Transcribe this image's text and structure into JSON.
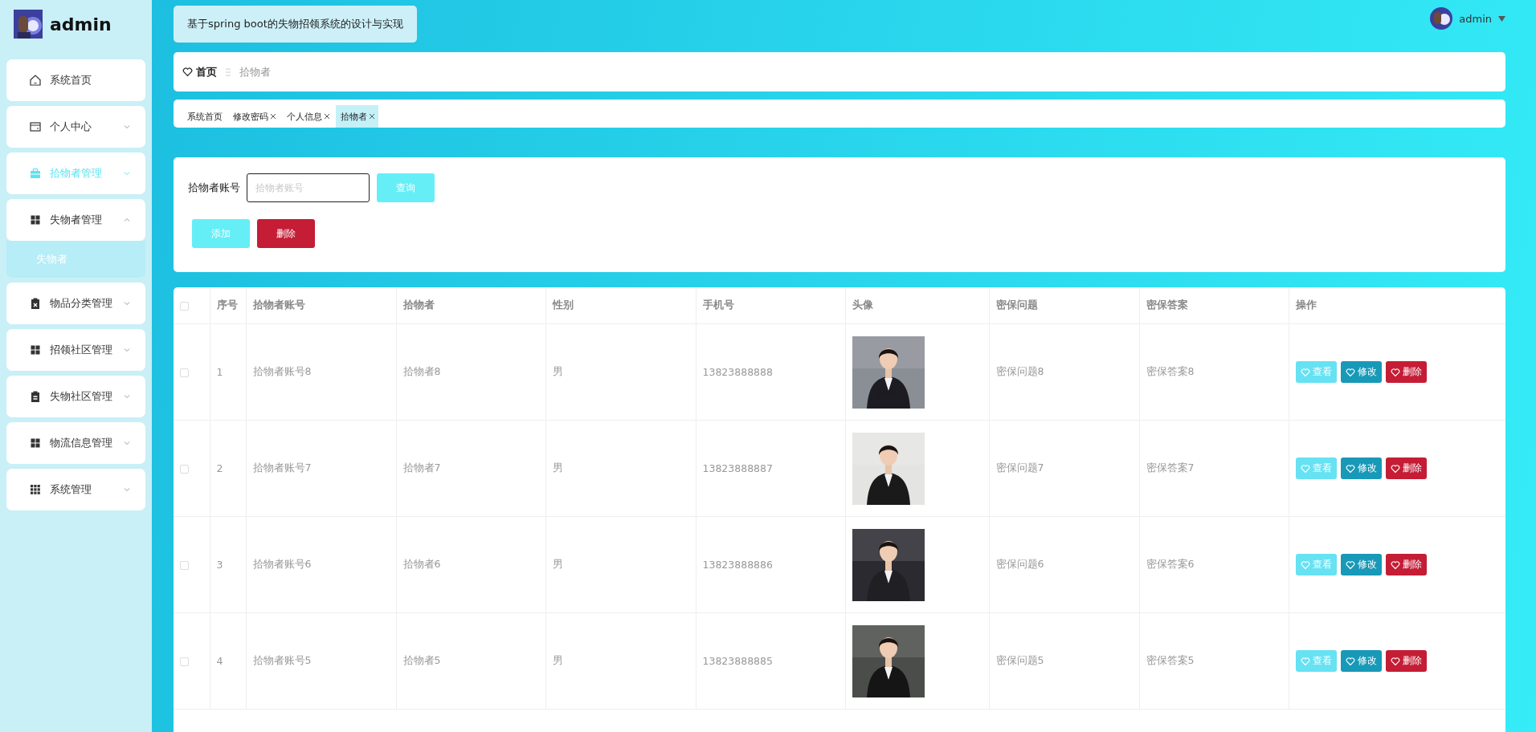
{
  "sidebar": {
    "brand": "admin",
    "items": [
      {
        "label": "系统首页",
        "kind": "link",
        "selected": false
      },
      {
        "label": "个人中心",
        "kind": "submenu",
        "selected": false,
        "expanded": false
      },
      {
        "label": "拾物者管理",
        "kind": "submenu",
        "selected": true,
        "expanded": false
      },
      {
        "label": "失物者管理",
        "kind": "submenu",
        "selected": false,
        "expanded": true,
        "children": [
          {
            "label": "失物者",
            "hovered": true
          }
        ]
      },
      {
        "label": "物品分类管理",
        "kind": "submenu",
        "selected": false,
        "expanded": false
      },
      {
        "label": "招领社区管理",
        "kind": "submenu",
        "selected": false,
        "expanded": false
      },
      {
        "label": "失物社区管理",
        "kind": "submenu",
        "selected": false,
        "expanded": false
      },
      {
        "label": "物流信息管理",
        "kind": "submenu",
        "selected": false,
        "expanded": false
      },
      {
        "label": "系统管理",
        "kind": "submenu",
        "selected": false,
        "expanded": false
      }
    ]
  },
  "header": {
    "title": "基于spring boot的失物招领系统的设计与实现",
    "user": "admin"
  },
  "breadcrumb": [
    {
      "label": "首页",
      "current": false
    },
    {
      "label": "拾物者",
      "current": true
    }
  ],
  "tabs": [
    {
      "label": "系统首页",
      "closable": false,
      "selected": false
    },
    {
      "label": "修改密码",
      "closable": true,
      "selected": false
    },
    {
      "label": "个人信息",
      "closable": true,
      "selected": false
    },
    {
      "label": "拾物者",
      "closable": true,
      "selected": true
    }
  ],
  "search": {
    "label": "拾物者账号",
    "placeholder": "拾物者账号",
    "button": "查询"
  },
  "toolbar": [
    {
      "label": "添加",
      "kind": "primary"
    },
    {
      "label": "删除",
      "kind": "danger"
    }
  ],
  "table": {
    "all_checked": false,
    "columns": [
      "序号",
      "拾物者账号",
      "拾物者",
      "性别",
      "手机号",
      "头像",
      "密保问题",
      "密保答案",
      "操作"
    ],
    "rows": [
      {
        "checked": false,
        "index": "1",
        "account": "拾物者账号8",
        "name": "拾物者8",
        "gender": "男",
        "phone": "13823888888",
        "avatar": {
          "kind": "picture"
        },
        "question": "密保问题8",
        "answer": "密保答案8",
        "actions": [
          {
            "label": "查看",
            "kind": "view"
          },
          {
            "label": "修改",
            "kind": "edit"
          },
          {
            "label": "删除",
            "kind": "delete"
          }
        ]
      },
      {
        "checked": false,
        "index": "2",
        "account": "拾物者账号7",
        "name": "拾物者7",
        "gender": "男",
        "phone": "13823888887",
        "avatar": {
          "kind": "picture"
        },
        "question": "密保问题7",
        "answer": "密保答案7",
        "actions": [
          {
            "label": "查看",
            "kind": "view"
          },
          {
            "label": "修改",
            "kind": "edit"
          },
          {
            "label": "删除",
            "kind": "delete"
          }
        ]
      },
      {
        "checked": false,
        "index": "3",
        "account": "拾物者账号6",
        "name": "拾物者6",
        "gender": "男",
        "phone": "13823888886",
        "avatar": {
          "kind": "picture"
        },
        "question": "密保问题6",
        "answer": "密保答案6",
        "actions": [
          {
            "label": "查看",
            "kind": "view"
          },
          {
            "label": "修改",
            "kind": "edit"
          },
          {
            "label": "删除",
            "kind": "delete"
          }
        ]
      },
      {
        "checked": false,
        "index": "4",
        "account": "拾物者账号5",
        "name": "拾物者5",
        "gender": "男",
        "phone": "13823888885",
        "avatar": {
          "kind": "picture"
        },
        "question": "密保问题5",
        "answer": "密保答案5",
        "actions": [
          {
            "label": "查看",
            "kind": "view"
          },
          {
            "label": "修改",
            "kind": "edit"
          },
          {
            "label": "删除",
            "kind": "delete"
          }
        ]
      }
    ]
  }
}
